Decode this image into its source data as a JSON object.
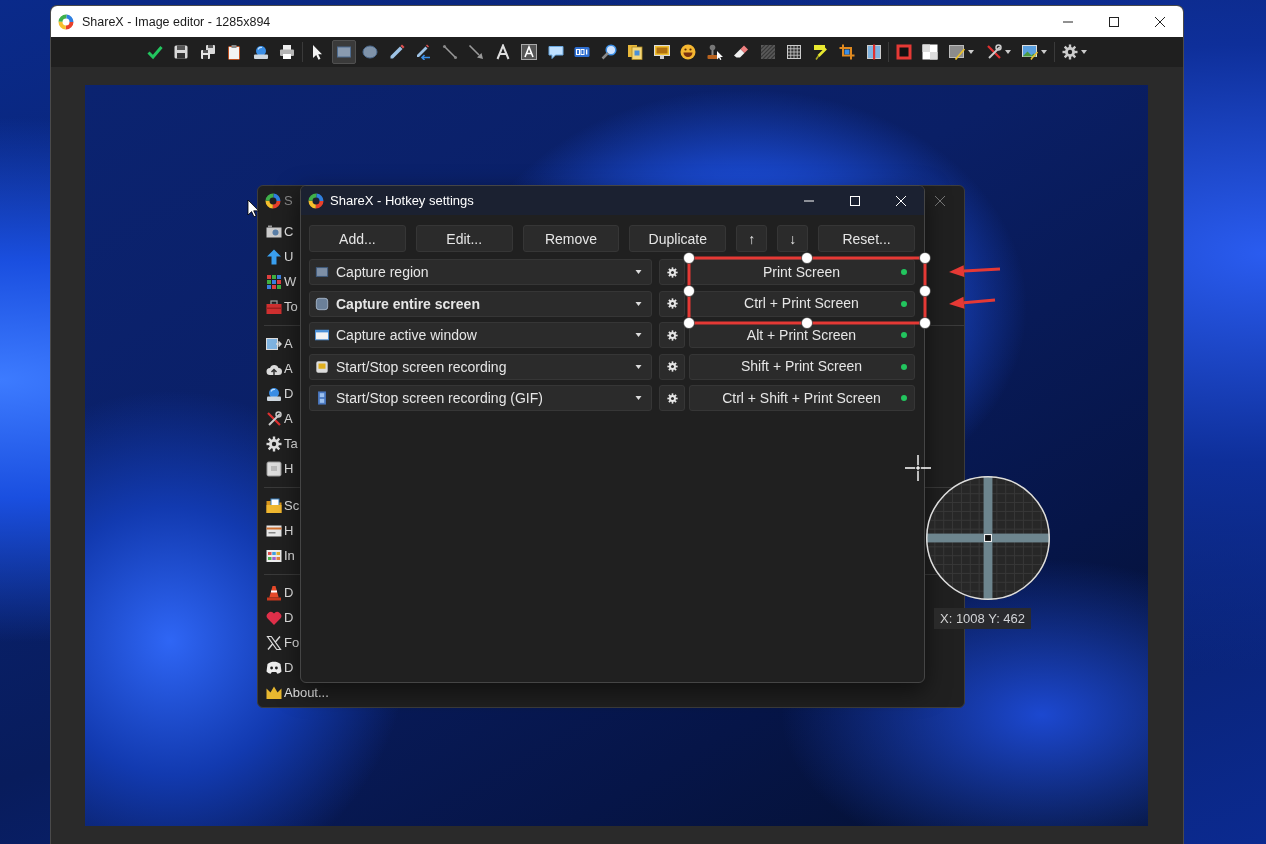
{
  "editor_window": {
    "title": "ShareX - Image editor - 1285x894"
  },
  "toolbar": {
    "groups": [
      {
        "tools": [
          {
            "kind": "confirm",
            "selected": false,
            "menu": false
          },
          {
            "kind": "save",
            "selected": false,
            "menu": false
          },
          {
            "kind": "save-as",
            "selected": false,
            "menu": false
          },
          {
            "kind": "copy",
            "selected": false,
            "menu": false
          },
          {
            "kind": "upload",
            "selected": false,
            "menu": false
          },
          {
            "kind": "print",
            "selected": false,
            "menu": false
          }
        ]
      },
      {
        "tools": [
          {
            "kind": "select",
            "selected": false,
            "menu": false
          },
          {
            "kind": "rectangle",
            "selected": true,
            "menu": false
          },
          {
            "kind": "ellipse",
            "selected": false,
            "menu": false
          },
          {
            "kind": "freehand",
            "selected": false,
            "menu": false
          },
          {
            "kind": "freehand-arrow",
            "selected": false,
            "menu": false
          },
          {
            "kind": "line",
            "selected": false,
            "menu": false
          },
          {
            "kind": "arrow",
            "selected": false,
            "menu": false
          },
          {
            "kind": "text-outline",
            "selected": false,
            "menu": false
          },
          {
            "kind": "text-background",
            "selected": false,
            "menu": false
          },
          {
            "kind": "speech-balloon",
            "selected": false,
            "menu": false
          },
          {
            "kind": "step",
            "selected": false,
            "menu": false
          },
          {
            "kind": "magnify",
            "selected": false,
            "menu": false
          },
          {
            "kind": "image-file",
            "selected": false,
            "menu": false
          },
          {
            "kind": "image-screen",
            "selected": false,
            "menu": false
          },
          {
            "kind": "emoji",
            "selected": false,
            "menu": false
          },
          {
            "kind": "cursor-stamp",
            "selected": false,
            "menu": false
          },
          {
            "kind": "eraser",
            "selected": false,
            "menu": false
          },
          {
            "kind": "blur",
            "selected": false,
            "menu": false
          },
          {
            "kind": "pixelate",
            "selected": false,
            "menu": false
          },
          {
            "kind": "highlight",
            "selected": false,
            "menu": false
          },
          {
            "kind": "crop",
            "selected": false,
            "menu": false
          },
          {
            "kind": "cut-out",
            "selected": false,
            "menu": false
          }
        ]
      },
      {
        "tools": [
          {
            "kind": "border-color",
            "selected": false,
            "menu": false
          },
          {
            "kind": "fill-color",
            "selected": false,
            "menu": false
          },
          {
            "kind": "shadow",
            "selected": false,
            "menu": true
          },
          {
            "kind": "tools",
            "selected": false,
            "menu": true
          },
          {
            "kind": "image-menu",
            "selected": false,
            "menu": true
          }
        ]
      },
      {
        "tools": [
          {
            "kind": "settings",
            "selected": false,
            "menu": true
          }
        ]
      }
    ]
  },
  "main_window": {
    "title": "S",
    "sidebar": {
      "groups": [
        {
          "items": [
            {
              "kind": "capture",
              "label": "C"
            },
            {
              "kind": "upload",
              "label": "U"
            },
            {
              "kind": "workflows",
              "label": "W"
            },
            {
              "kind": "tools",
              "label": "To"
            }
          ]
        },
        {
          "items": [
            {
              "kind": "after-capture",
              "label": "A"
            },
            {
              "kind": "after-upload",
              "label": "A"
            },
            {
              "kind": "destinations",
              "label": "D"
            },
            {
              "kind": "app-settings",
              "label": "A"
            },
            {
              "kind": "task-settings",
              "label": "Ta"
            },
            {
              "kind": "hotkey-settings",
              "label": "H"
            }
          ]
        },
        {
          "items": [
            {
              "kind": "screenshots-folder",
              "label": "Sc"
            },
            {
              "kind": "history",
              "label": "H"
            },
            {
              "kind": "image-history",
              "label": "In"
            }
          ]
        },
        {
          "items": [
            {
              "kind": "debug",
              "label": "D"
            },
            {
              "kind": "donate",
              "label": "D"
            },
            {
              "kind": "follow",
              "label": "Fo"
            },
            {
              "kind": "discord",
              "label": "D"
            },
            {
              "kind": "about",
              "label": "About..."
            }
          ]
        }
      ]
    }
  },
  "hotkey_dialog": {
    "title": "ShareX - Hotkey settings",
    "buttons": [
      "Add...",
      "Edit...",
      "Remove",
      "Duplicate",
      "↑",
      "↓",
      "Reset..."
    ],
    "hotkeys": [
      {
        "kind": "region",
        "task": "Capture region",
        "emphasized": false,
        "hotkey": "Print Screen",
        "registered": true
      },
      {
        "kind": "fullscreen",
        "task": "Capture entire screen",
        "emphasized": true,
        "hotkey": "Ctrl + Print Screen",
        "registered": true
      },
      {
        "kind": "window",
        "task": "Capture active window",
        "emphasized": false,
        "hotkey": "Alt + Print Screen",
        "registered": true
      },
      {
        "kind": "recording",
        "task": "Start/Stop screen recording",
        "emphasized": false,
        "hotkey": "Shift + Print Screen",
        "registered": true
      },
      {
        "kind": "gif",
        "task": "Start/Stop screen recording (GIF)",
        "emphasized": false,
        "hotkey": "Ctrl + Shift + Print Screen",
        "registered": true
      }
    ]
  },
  "magnifier": {
    "coordinates": "X: 1008 Y: 462"
  }
}
